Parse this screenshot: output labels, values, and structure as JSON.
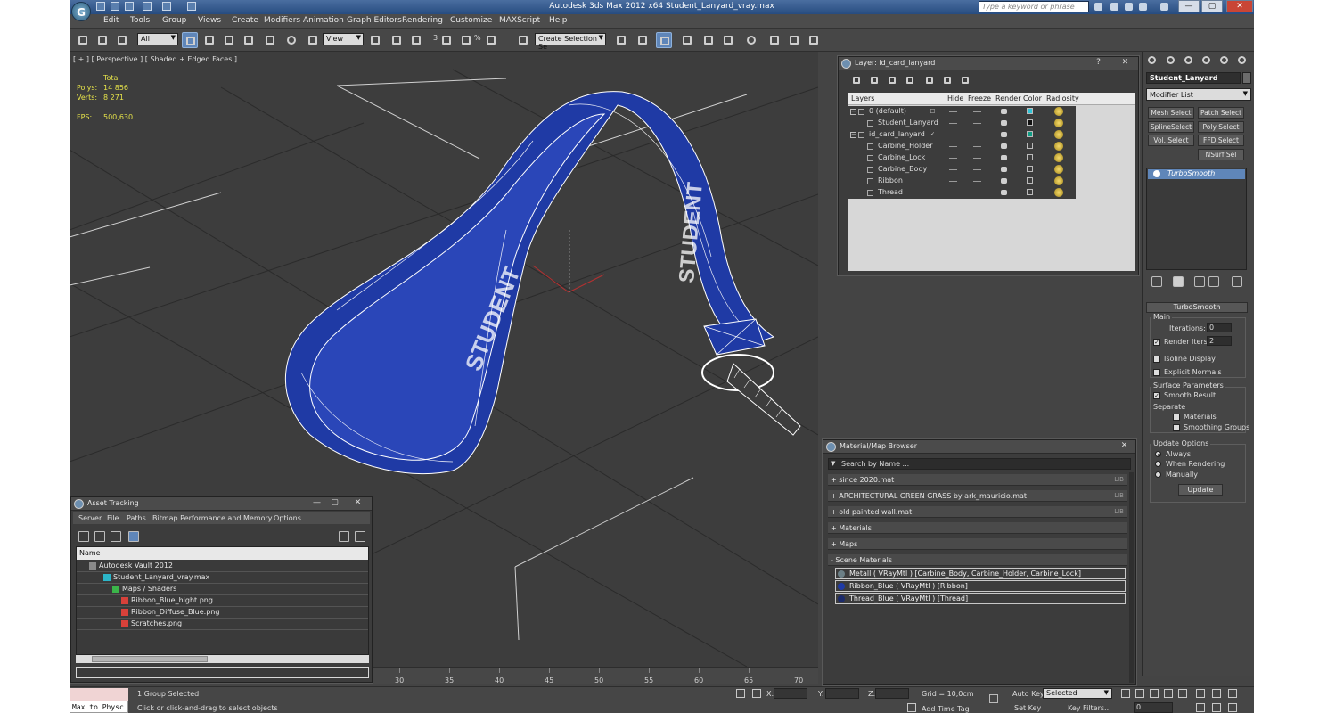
{
  "app": {
    "title": "Autodesk 3ds Max  2012 x64      Student_Lanyard_vray.max",
    "logo": "G",
    "help_placeholder": "Type a keyword or phrase",
    "win_buttons": [
      "—",
      "▢",
      "✕"
    ]
  },
  "menu": [
    "Edit",
    "Tools",
    "Group",
    "Views",
    "Create",
    "Modifiers",
    "Animation",
    "Graph Editors",
    "Rendering",
    "Customize",
    "MAXScript",
    "Help"
  ],
  "toolbar": {
    "filter_value": "All",
    "refcoord_value": "View",
    "selection_set_placeholder": "Create Selection Se",
    "snap_labels": [
      "3",
      "n",
      "%",
      "n"
    ]
  },
  "viewport": {
    "label": "[ + ] [ Perspective ] [ Shaded + Edged Faces ]",
    "stats_header": "Total",
    "stats": [
      {
        "key": "Polys:",
        "value": "14 856"
      },
      {
        "key": "Verts:",
        "value": "8 271"
      }
    ],
    "fps_key": "FPS:",
    "fps_value": "500,630",
    "ribbon_text": "STUDENT",
    "colors": {
      "bg": "#3d3d3d",
      "grid": "#2a2a2a",
      "ribbon": "#1f3aa5",
      "wire": "#ffffff"
    }
  },
  "layer_dialog": {
    "title": "Layer: id_card_lanyard",
    "buttons": [
      "?",
      "✕"
    ],
    "columns": [
      "Layers",
      "Hide",
      "Freeze",
      "Render",
      "Color",
      "Radiosity"
    ],
    "rows": [
      {
        "name": "0 (default)",
        "indent": 0,
        "color": "#2ec4d8",
        "current": false,
        "toggle": "□"
      },
      {
        "name": "Student_Lanyard",
        "indent": 1,
        "color": "#111111",
        "current": false,
        "toggle": ""
      },
      {
        "name": "id_card_lanyard",
        "indent": 0,
        "color": "#0f9c84",
        "current": true,
        "toggle": "✓"
      },
      {
        "name": "Carbine_Holder",
        "indent": 1,
        "color": "#3c3c3c",
        "current": false,
        "toggle": ""
      },
      {
        "name": "Carbine_Lock",
        "indent": 1,
        "color": "#3c3c3c",
        "current": false,
        "toggle": ""
      },
      {
        "name": "Carbine_Body",
        "indent": 1,
        "color": "#3c3c3c",
        "current": false,
        "toggle": ""
      },
      {
        "name": "Ribbon",
        "indent": 1,
        "color": "#3c3c3c",
        "current": false,
        "toggle": ""
      },
      {
        "name": "Thread",
        "indent": 1,
        "color": "#3c3c3c",
        "current": false,
        "toggle": ""
      }
    ]
  },
  "command_panel": {
    "object_name": "Student_Lanyard",
    "modifier_list": "Modifier List",
    "modifier_buttons": [
      "Mesh Select",
      "Patch Select",
      "SplineSelect",
      "Poly Select",
      "Vol. Select",
      "FFD Select",
      "NSurf Sel"
    ],
    "stack_item": "TurboSmooth",
    "rollout": {
      "title": "TurboSmooth",
      "main_label": "Main",
      "iterations_label": "Iterations:",
      "iterations_value": "0",
      "render_iters_label": "Render Iters:",
      "render_iters_value": "2",
      "render_iters_checked": "✓",
      "isoline_label": "Isoline Display",
      "explicit_normals_label": "Explicit Normals",
      "surface_params_label": "Surface Parameters",
      "smooth_result_label": "Smooth Result",
      "smooth_result_checked": "✓",
      "separate_label": "Separate",
      "materials_label": "Materials",
      "smoothing_groups_label": "Smoothing Groups",
      "update_options_label": "Update Options",
      "update_options": [
        "Always",
        "When Rendering",
        "Manually"
      ],
      "update_selected": 0,
      "update_button": "Update"
    }
  },
  "material_browser": {
    "title": "Material/Map Browser",
    "close": "✕",
    "search_placeholder": "Search by Name ...",
    "groups": [
      {
        "label": "+ since 2020.mat",
        "tag": "LIB"
      },
      {
        "label": "+ ARCHITECTURAL GREEN GRASS by ark_mauricio.mat",
        "tag": "LIB"
      },
      {
        "label": "+ old painted wall.mat",
        "tag": "LIB"
      },
      {
        "label": "+ Materials",
        "tag": ""
      },
      {
        "label": "+ Maps",
        "tag": ""
      },
      {
        "label": "- Scene Materials",
        "tag": ""
      }
    ],
    "scene_materials": [
      {
        "label": "Metall  ( VRayMtl )  [Carbine_Body, Carbine_Holder, Carbine_Lock]",
        "swatch": "#6b7f86"
      },
      {
        "label": "Ribbon_Blue  ( VRayMtl )  [Ribbon]",
        "swatch": "#1f3aa5"
      },
      {
        "label": "Thread_Blue  ( VRayMtl )  [Thread]",
        "swatch": "#1b2a6b"
      }
    ]
  },
  "asset_tracking": {
    "title": "Asset Tracking",
    "buttons": [
      "—",
      "▢",
      "✕"
    ],
    "menu": [
      "Server",
      "File",
      "Paths",
      "Bitmap Performance and Memory",
      "Options"
    ],
    "column": "Name",
    "rows": [
      {
        "name": "Autodesk Vault 2012",
        "indent": 14,
        "icon": "#8a8a8a"
      },
      {
        "name": "Student_Lanyard_vray.max",
        "indent": 30,
        "icon": "#2cb6c9"
      },
      {
        "name": "Maps / Shaders",
        "indent": 40,
        "icon": "#3bb54a"
      },
      {
        "name": "Ribbon_Blue_hight.png",
        "indent": 50,
        "icon": "#d8413a"
      },
      {
        "name": "Ribbon_Diffuse_Blue.png",
        "indent": 50,
        "icon": "#d8413a"
      },
      {
        "name": "Scratches.png",
        "indent": 50,
        "icon": "#d8413a"
      }
    ]
  },
  "timeline": {
    "ticks": [
      "30",
      "35",
      "40",
      "45",
      "50",
      "55",
      "60",
      "65",
      "70"
    ]
  },
  "status": {
    "maxscript": "Max to Physc",
    "selected": "1 Group Selected",
    "prompt": "Click or click-and-drag to select objects",
    "x_label": "X:",
    "y_label": "Y:",
    "z_label": "Z:",
    "grid": "Grid = 10,0cm",
    "add_time_tag": "Add Time Tag",
    "auto_key": "Auto Key",
    "set_key": "Set Key",
    "selected_value": "Selected",
    "key_filters": "Key Filters...",
    "frame": "0"
  }
}
